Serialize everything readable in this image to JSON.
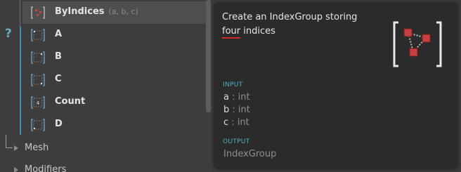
{
  "help_glyph": "?",
  "nodes": [
    {
      "label": "ByIndices",
      "args": "(a, b, c)",
      "icon": "index-group-icon"
    },
    {
      "label": "A",
      "icon": "index-icon"
    },
    {
      "label": "B",
      "icon": "index-icon"
    },
    {
      "label": "C",
      "icon": "index-icon"
    },
    {
      "label": "Count",
      "icon": "count-icon"
    },
    {
      "label": "D",
      "icon": "index-icon"
    }
  ],
  "categories": [
    {
      "label": "Mesh"
    },
    {
      "label": "Modifiers"
    }
  ],
  "tooltip": {
    "desc_before": "Create an IndexGroup storing ",
    "desc_highlight": "four",
    "desc_after": " indices",
    "input_title": "INPUT",
    "inputs": [
      {
        "name": "a",
        "sep": " : ",
        "type": "int"
      },
      {
        "name": "b",
        "sep": " : ",
        "type": "int"
      },
      {
        "name": "c",
        "sep": " : ",
        "type": "int"
      }
    ],
    "output_title": "OUTPUT",
    "output_type": "IndexGroup",
    "icon": "index-group-icon",
    "colors": {
      "accent": "#4fb0c6",
      "node_red": "#c84040",
      "underline": "#d22b2b"
    }
  }
}
